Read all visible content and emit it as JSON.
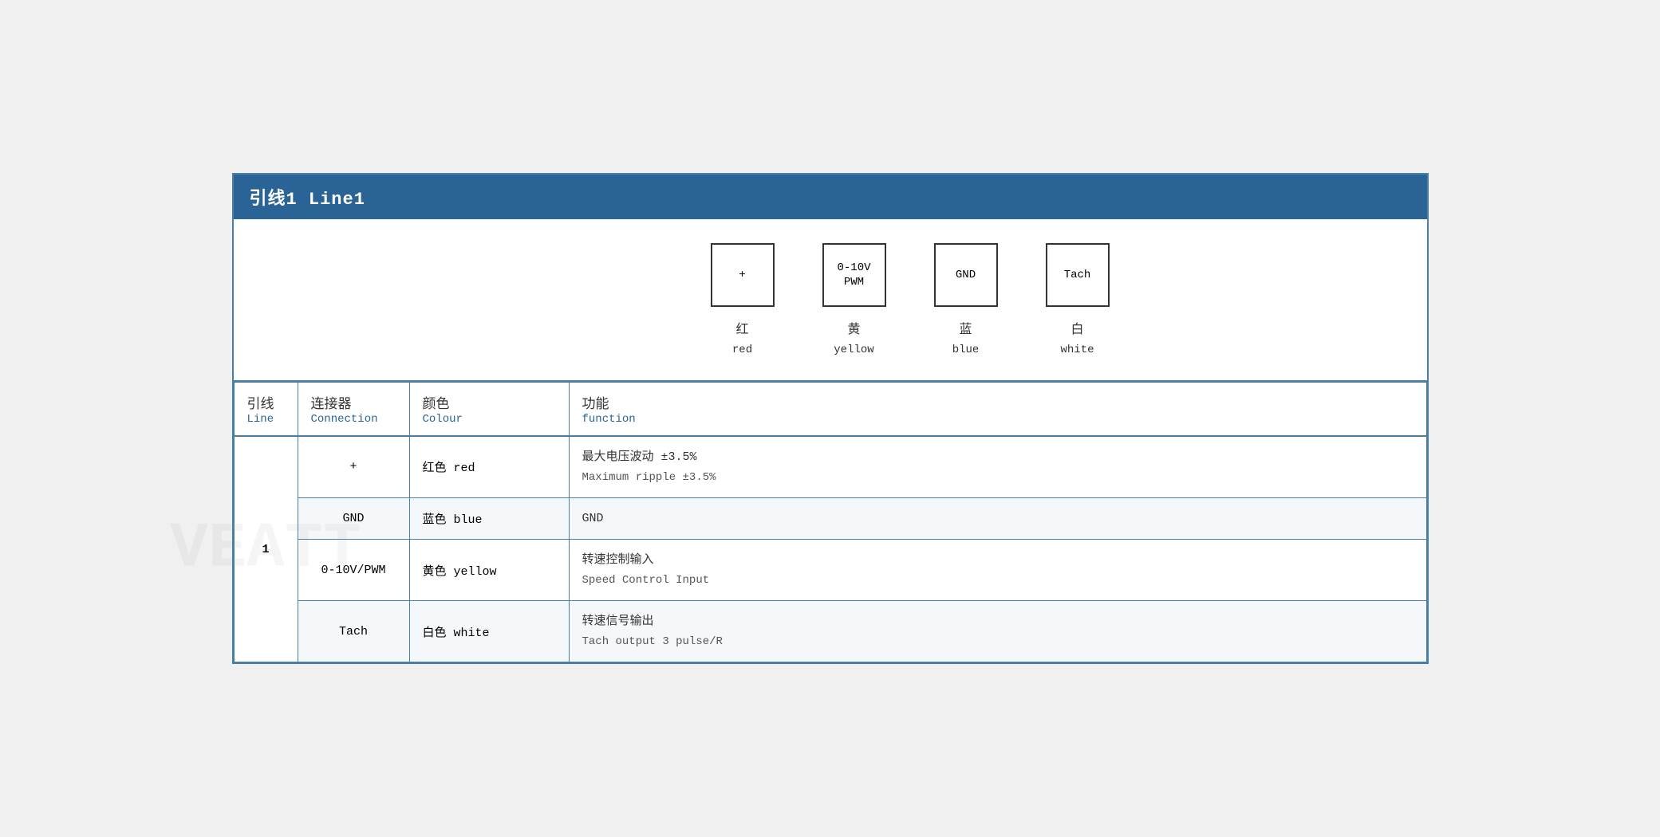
{
  "header": {
    "title": "引线1 Line1"
  },
  "diagram": {
    "pins": [
      {
        "id": "pin-plus",
        "symbol": "+",
        "label_cn": "红",
        "label_en": "red"
      },
      {
        "id": "pin-pwm",
        "symbol": "0-10V\nPWM",
        "label_cn": "黄",
        "label_en": "yellow"
      },
      {
        "id": "pin-gnd",
        "symbol": "GND",
        "label_cn": "蓝",
        "label_en": "blue"
      },
      {
        "id": "pin-tach",
        "symbol": "Tach",
        "label_cn": "白",
        "label_en": "white"
      }
    ]
  },
  "table": {
    "columns": [
      {
        "cn": "引线",
        "en": "Line"
      },
      {
        "cn": "连接器",
        "en": "Connection"
      },
      {
        "cn": "颜色",
        "en": "Colour"
      },
      {
        "cn": "功能",
        "en": "function"
      }
    ],
    "rows": [
      {
        "line": "1",
        "connection": "+",
        "colour_cn": "红色",
        "colour_en": "red",
        "func_cn": "最大电压波动 ±3.5%",
        "func_en": "Maximum ripple ±3.5%"
      },
      {
        "line": "",
        "connection": "GND",
        "colour_cn": "蓝色",
        "colour_en": "blue",
        "func_cn": "GND",
        "func_en": ""
      },
      {
        "line": "",
        "connection": "0-10V/PWM",
        "colour_cn": "黄色",
        "colour_en": "yellow",
        "func_cn": "转速控制输入",
        "func_en": "Speed Control Input"
      },
      {
        "line": "",
        "connection": "Tach",
        "colour_cn": "白色",
        "colour_en": "white",
        "func_cn": "转速信号输出",
        "func_en": "Tach output 3 pulse/R"
      }
    ]
  }
}
